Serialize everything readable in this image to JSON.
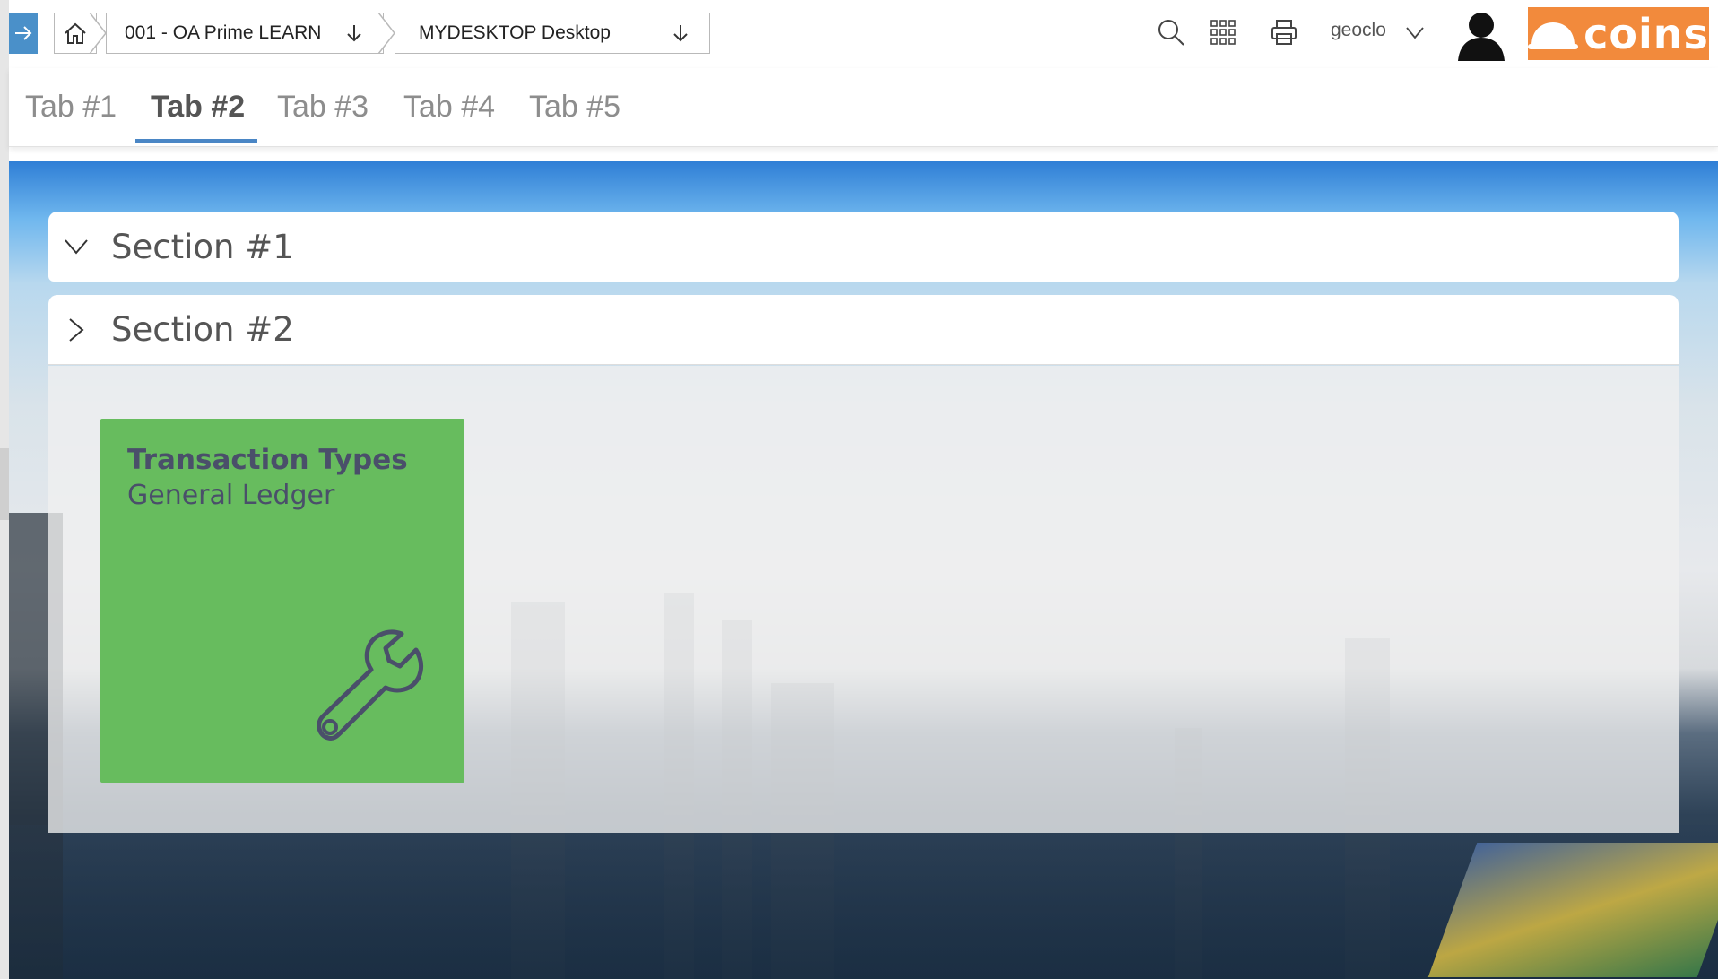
{
  "breadcrumb": {
    "company": "001 - OA Prime LEARN",
    "desktop": "MYDESKTOP Desktop"
  },
  "header": {
    "user_name": "geoclo",
    "logo_text": "coins",
    "logo_color": "#f28a3c"
  },
  "tabs": [
    {
      "label": "Tab #1",
      "active": false
    },
    {
      "label": "Tab #2",
      "active": true
    },
    {
      "label": "Tab #3",
      "active": false
    },
    {
      "label": "Tab #4",
      "active": false
    },
    {
      "label": "Tab #5",
      "active": false
    }
  ],
  "sections": [
    {
      "title": "Section #1",
      "expanded": true
    },
    {
      "title": "Section #2",
      "expanded": false
    }
  ],
  "tile": {
    "title": "Transaction Types",
    "subtitle": "General Ledger",
    "icon": "wrench-icon",
    "color": "#67bc5e"
  },
  "colors": {
    "accent": "#4a86c5"
  }
}
